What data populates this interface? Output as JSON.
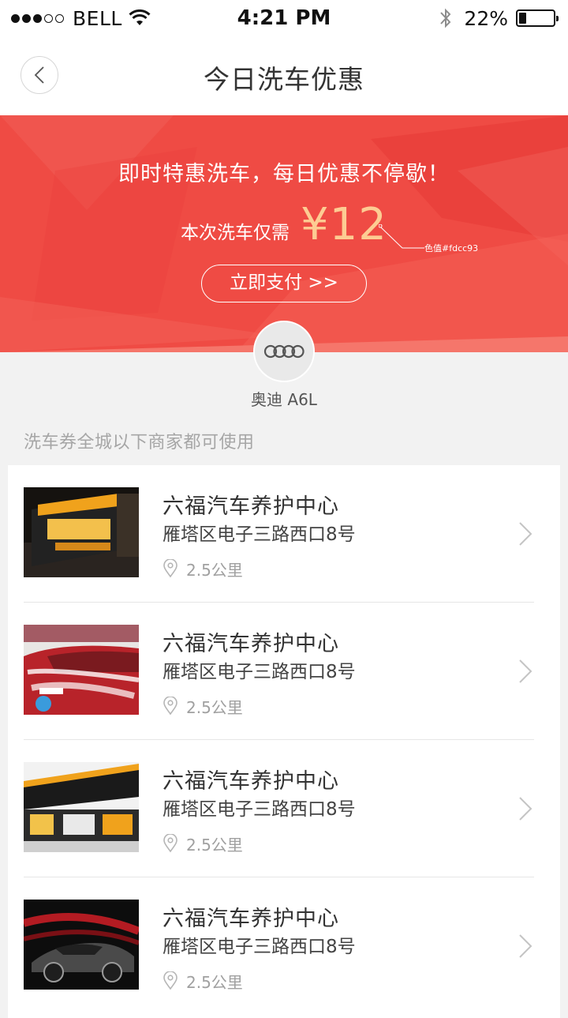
{
  "status_bar": {
    "carrier": "BELL",
    "time": "4:21 PM",
    "battery_percent": "22%",
    "battery_level": 0.22,
    "signal_icon": "signal-dots-icon",
    "wifi_icon": "wifi-icon",
    "bluetooth_icon": "bluetooth-icon"
  },
  "nav": {
    "title": "今日洗车优惠",
    "back_icon": "chevron-left-icon"
  },
  "banner": {
    "headline": "即时特惠洗车，每日优惠不停歇！",
    "price_label": "本次洗车仅需",
    "price": "¥12",
    "annotation": "色值#fdcc93",
    "pay_button": "立即支付 >>",
    "price_color": "#fdcc93",
    "background_color": "#ef4b44"
  },
  "car": {
    "logo_icon": "audi-logo-icon",
    "name": "奥迪 A6L"
  },
  "section_note": "洗车券全城以下商家都可使用",
  "shops": [
    {
      "name": "六福汽车养护中心",
      "address": "雁塔区电子三路西口8号",
      "distance": "2.5公里",
      "thumb": "storefront-photo"
    },
    {
      "name": "六福汽车养护中心",
      "address": "雁塔区电子三路西口8号",
      "distance": "2.5公里",
      "thumb": "car-wash-photo"
    },
    {
      "name": "六福汽车养护中心",
      "address": "雁塔区电子三路西口8号",
      "distance": "2.5公里",
      "thumb": "storefront-photo"
    },
    {
      "name": "六福汽车养护中心",
      "address": "雁塔区电子三路西口8号",
      "distance": "2.5公里",
      "thumb": "car-photo"
    }
  ]
}
